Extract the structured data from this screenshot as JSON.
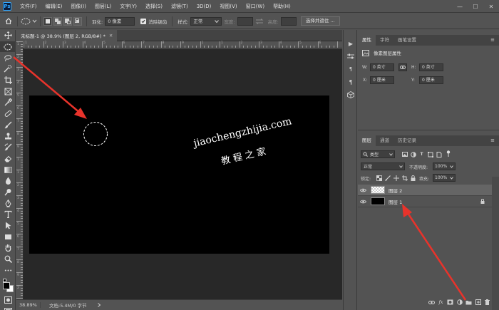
{
  "app": {
    "logo_text": "Ps",
    "menu": [
      "文件(F)",
      "编辑(E)",
      "图像(I)",
      "图层(L)",
      "文字(Y)",
      "选择(S)",
      "滤镜(T)",
      "3D(D)",
      "视图(V)",
      "窗口(W)",
      "帮助(H)"
    ],
    "window_controls": [
      "—",
      "☐",
      "✕"
    ]
  },
  "options_bar": {
    "feather_label": "羽化:",
    "feather_value": "0 像素",
    "antialias_label": "消除锯齿",
    "antialias_checked": true,
    "style_label": "样式:",
    "style_value": "正常",
    "width_label": "宽度:",
    "height_label": "高度:",
    "select_mask_button": "选择并遮住 ..."
  },
  "document": {
    "tab_title": "未标题-1 @ 38.9% (图层 2, RGB/8#) *",
    "zoom": "38.89%",
    "doc_info": "文档:5.4M/0 字节",
    "ruler_top_labels": [
      "1",
      "2",
      "3",
      "4",
      "5",
      "6",
      "7",
      "8",
      "9",
      "1",
      "1",
      "2",
      "3",
      "4",
      "5",
      "6"
    ],
    "ruler_left_labels": [
      "1",
      "2",
      "3",
      "4",
      "5",
      "6",
      "7",
      "8",
      "9",
      "1",
      "1",
      "2",
      "3",
      "4",
      "5",
      "6",
      "7",
      "8",
      "9",
      "2"
    ],
    "watermark_url": "jiaochengzhijia.com",
    "watermark_name": "教程之家"
  },
  "properties_panel": {
    "tabs": [
      "属性",
      "字符",
      "画笔设置"
    ],
    "active_tab": 0,
    "header": "像素图层属性",
    "w_label": "W:",
    "w_value": "0 英寸",
    "h_label": "H:",
    "h_value": "0 英寸",
    "x_label": "X:",
    "x_value": "0 厘米",
    "y_label": "Y:",
    "y_value": "0 厘米"
  },
  "layers_panel": {
    "tabs": [
      "图层",
      "通道",
      "历史记录"
    ],
    "active_tab": 0,
    "filter_kind": "类型",
    "blend_mode": "正常",
    "opacity_label": "不透明度:",
    "opacity_value": "100%",
    "lock_label": "锁定:",
    "fill_label": "填充:",
    "fill_value": "100%",
    "layers": [
      {
        "name": "图层 2",
        "selected": true,
        "thumb": "transparent",
        "locked": false
      },
      {
        "name": "图层 1",
        "selected": false,
        "thumb": "black",
        "locked": true
      }
    ]
  },
  "colors": {
    "accent_arrow": "#e8332b",
    "canvas_fill": "#000000",
    "pasteboard": "#282828",
    "ui_gray": "#535353"
  }
}
